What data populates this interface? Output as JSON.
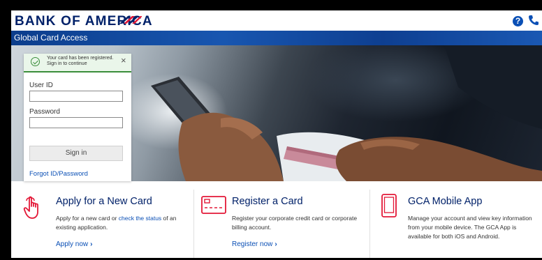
{
  "header": {
    "logo_text": "BANK OF AMERICA",
    "help_icon": "question-circle-icon",
    "phone_icon": "phone-icon"
  },
  "subbar": {
    "title": "Global Card Access"
  },
  "login": {
    "alert_line1": "Your card has been registered.",
    "alert_line2": "Sign in to continue",
    "alert_close": "×",
    "user_id_label": "User ID",
    "user_id_value": "",
    "password_label": "Password",
    "password_value": "",
    "signin_label": "Sign in",
    "forgot_label": "Forgot ID/Password"
  },
  "features": [
    {
      "icon": "hand-tap-icon",
      "title": "Apply for a New Card",
      "desc_before": "Apply for a new card or ",
      "desc_link": "check the status",
      "desc_after": " of an existing application.",
      "link": "Apply now"
    },
    {
      "icon": "credit-card-icon",
      "title": "Register a Card",
      "desc": "Register your corporate credit card or corporate billing account.",
      "link": "Register now"
    },
    {
      "icon": "mobile-phone-icon",
      "title": "GCA Mobile App",
      "desc": "Manage your account and view key information from your mobile device. The GCA App is available for both iOS and Android."
    }
  ],
  "colors": {
    "brand_navy": "#012169",
    "brand_red": "#e31837",
    "link_blue": "#0a4fb5",
    "success_green": "#3a8d3a"
  }
}
